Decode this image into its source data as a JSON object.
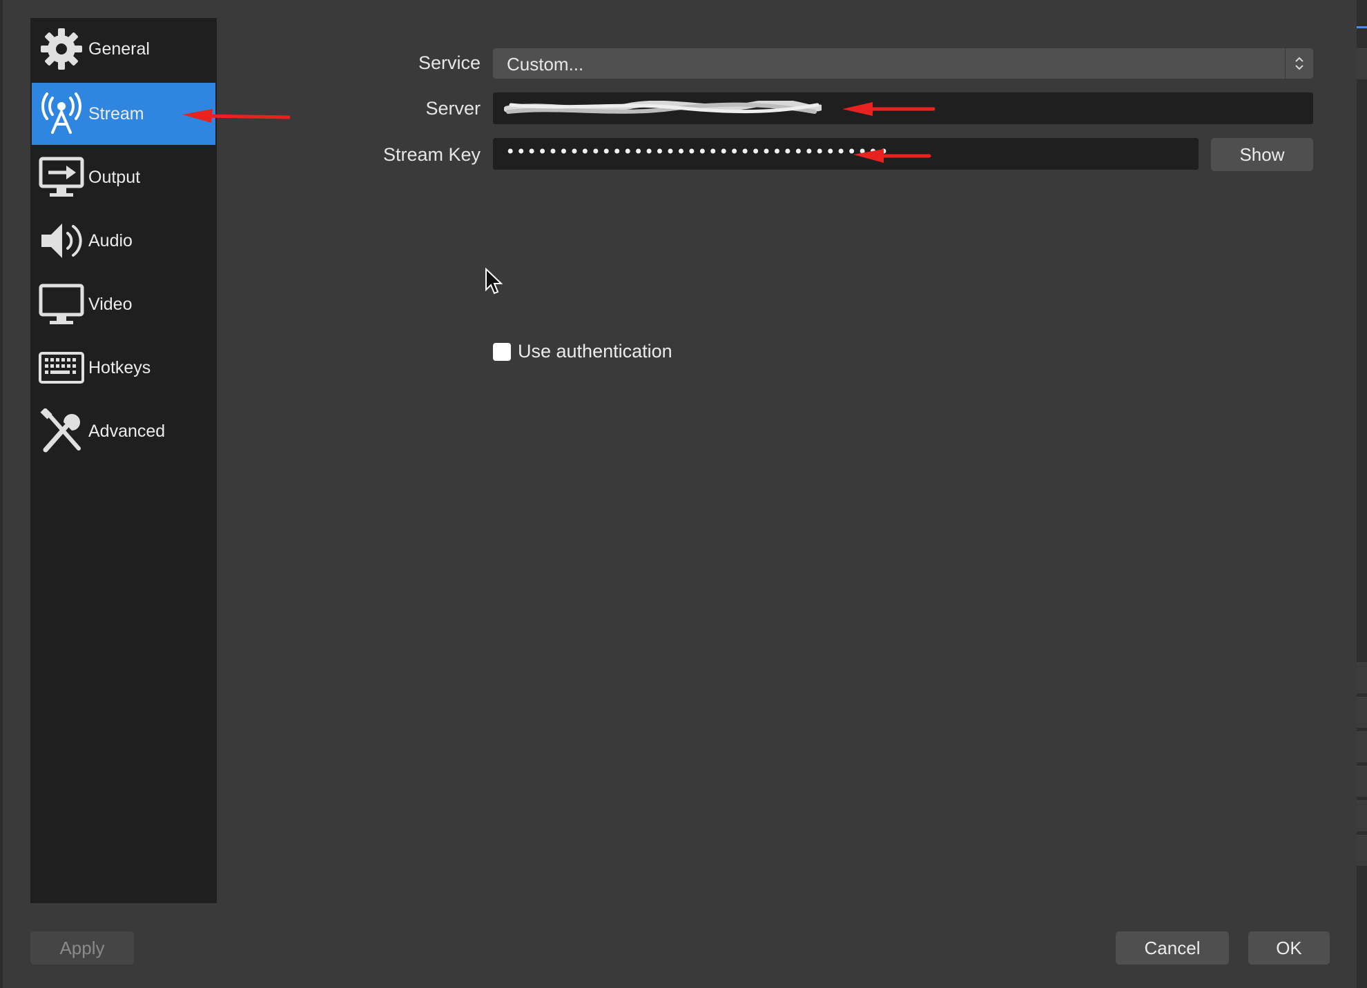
{
  "sidebar": {
    "items": [
      {
        "label": "General",
        "icon": "gear-icon",
        "active": false
      },
      {
        "label": "Stream",
        "icon": "broadcast-antenna-icon",
        "active": true
      },
      {
        "label": "Output",
        "icon": "monitor-arrow-icon",
        "active": false
      },
      {
        "label": "Audio",
        "icon": "speaker-icon",
        "active": false
      },
      {
        "label": "Video",
        "icon": "monitor-icon",
        "active": false
      },
      {
        "label": "Hotkeys",
        "icon": "keyboard-icon",
        "active": false
      },
      {
        "label": "Advanced",
        "icon": "tools-icon",
        "active": false
      }
    ]
  },
  "stream": {
    "service_label": "Service",
    "service_value": "Custom...",
    "server_label": "Server",
    "server_value": "",
    "stream_key_label": "Stream Key",
    "stream_key_value": "••••••••••••••••••••••••••••••••••••",
    "show_button": "Show",
    "use_auth_label": "Use authentication",
    "use_auth_checked": false
  },
  "footer": {
    "apply": "Apply",
    "cancel": "Cancel",
    "ok": "OK"
  },
  "colors": {
    "accent": "#2f86e1",
    "annotation_arrow": "#e8231f",
    "background": "#3a3a3a",
    "sidebar": "#1f1f1f"
  }
}
